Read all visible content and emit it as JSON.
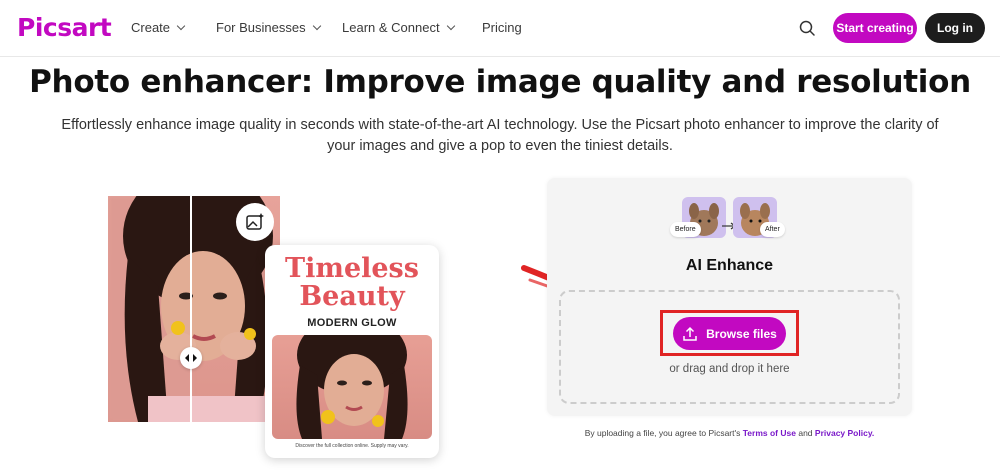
{
  "nav": {
    "logo": "Picsart",
    "items": [
      {
        "label": "Create",
        "has_dropdown": true
      },
      {
        "label": "For Businesses",
        "has_dropdown": true
      },
      {
        "label": "Learn & Connect",
        "has_dropdown": true
      },
      {
        "label": "Pricing",
        "has_dropdown": false
      }
    ],
    "search_icon": "search-icon",
    "start_label": "Start creating",
    "login_label": "Log in"
  },
  "hero": {
    "title": "Photo enhancer: Improve image quality and resolution",
    "subtitle": "Effortlessly enhance image quality in seconds with state-of-the-art AI technology. Use the Picsart photo enhancer to improve the clarity of your images and give a pop to even the tiniest details."
  },
  "showcase": {
    "magazine_title_line1": "Timeless",
    "magazine_title_line2": "Beauty",
    "magazine_subtitle": "MODERN GLOW",
    "magazine_footer": "Discover the full collection online. Supply may vary."
  },
  "upload": {
    "before_label": "Before",
    "after_label": "After",
    "title": "AI Enhance",
    "browse_label": "Browse files",
    "drop_hint": "or drag and drop it here",
    "terms_prefix": "By uploading a file, you agree to Picsart's",
    "terms_link": "Terms of Use",
    "terms_and": "and",
    "privacy_link": "Privacy Policy."
  },
  "colors": {
    "brand": "#c209c1",
    "dark": "#1d1d1d",
    "highlight": "#e02424",
    "link": "#7a18c9"
  }
}
